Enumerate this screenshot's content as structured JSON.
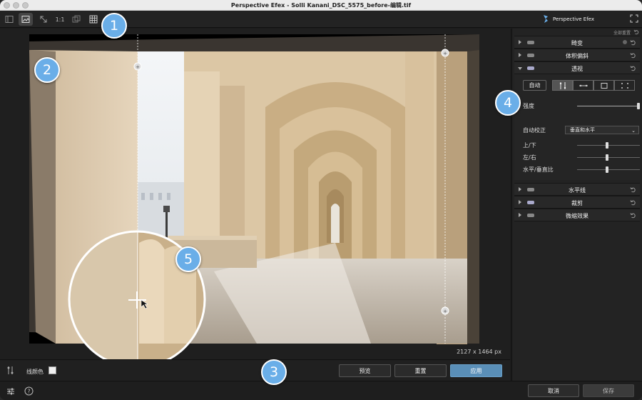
{
  "window": {
    "title": "Perspective Efex - Solli Kanani_DSC_5575_before-编辑.tif"
  },
  "toolbar": {
    "zoom_label": "1:1",
    "brand_name": "Perspective Efex"
  },
  "canvas": {
    "image_dimensions": "2127 x 1464 px"
  },
  "bottombar": {
    "line_color_label": "线颜色",
    "line_color": "#f0f0f0",
    "preview_label": "预览",
    "reset_label": "重置",
    "apply_label": "应用"
  },
  "footer": {
    "cancel_label": "取消",
    "save_label": "保存"
  },
  "panel": {
    "reset_all": "全部重置",
    "sections": {
      "distortion": "畸变",
      "tilt_shift": "体积偏斜",
      "perspective": "透视",
      "horizon": "水平线",
      "crop": "裁剪",
      "fine_effects": "微缩效果"
    },
    "perspective": {
      "auto_label": "自动",
      "strength_label": "强度",
      "strength_value": 1.0,
      "auto_correct_label": "自动校正",
      "auto_correct_value": "垂直和水平",
      "up_down_label": "上/下",
      "up_down_value": 0.5,
      "left_right_label": "左/右",
      "left_right_value": 0.5,
      "aspect_label": "水平/垂直比",
      "aspect_value": 0.5
    }
  },
  "badges": [
    "1",
    "2",
    "3",
    "4",
    "5"
  ],
  "colors": {
    "accent": "#6aaee8",
    "apply_button": "#5a8fb8"
  }
}
